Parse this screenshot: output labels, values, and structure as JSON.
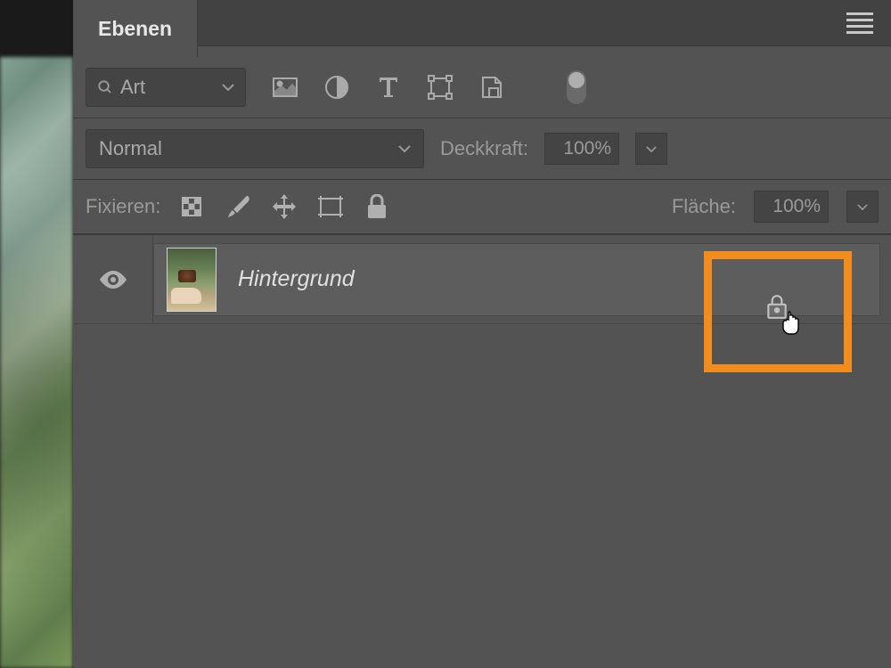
{
  "panel": {
    "tab_label": "Ebenen"
  },
  "filter": {
    "label": "Art"
  },
  "blend": {
    "mode": "Normal",
    "opacity_label": "Deckkraft:",
    "opacity_value": "100%"
  },
  "locks": {
    "label": "Fixieren:",
    "fill_label": "Fläche:",
    "fill_value": "100%"
  },
  "layers": [
    {
      "name": "Hintergrund",
      "visible": true,
      "locked": true
    }
  ],
  "highlight_color": "#f28c1c"
}
